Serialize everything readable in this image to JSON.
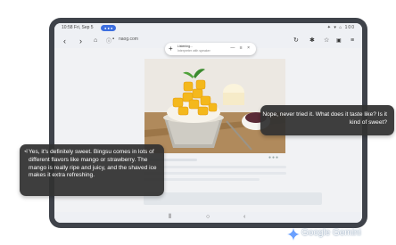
{
  "status_bar": {
    "time": "10:58 Fri, Sep 5",
    "recording_pill": "● ● ●",
    "icons": "✦ ▾ ⌂ 100"
  },
  "browser": {
    "url": "naog.com",
    "widget": {
      "title": "Listening...",
      "subtitle": "Interpreter with speaker",
      "buttons": "— ≡ ×"
    },
    "icons": {
      "back": "arrow-left-icon",
      "forward": "arrow-right-icon",
      "home": "home-icon",
      "info": "info-icon",
      "lock": "lock-icon",
      "reload": "reload-icon",
      "extension": "extension-icon",
      "bookmark": "star-icon",
      "tabs": "tabs-icon",
      "menu": "menu-icon"
    }
  },
  "conversation": {
    "reply_right": "Nope, never tried it. What does it taste like? Is it kind of sweet?",
    "message_left": "Yes, it's definitely sweet. Bingsu comes in lots of different flavors like mango or strawberry. The mango is really ripe and juicy, and the shaved ice makes it extra refreshing."
  },
  "nav": {
    "recents": "recents-icon",
    "home": "home-icon",
    "back": "back-icon"
  },
  "watermark": "Google Gemini",
  "colors": {
    "accent": "#3d6fe0",
    "bubble": "#323232",
    "frame": "#3f434a"
  }
}
